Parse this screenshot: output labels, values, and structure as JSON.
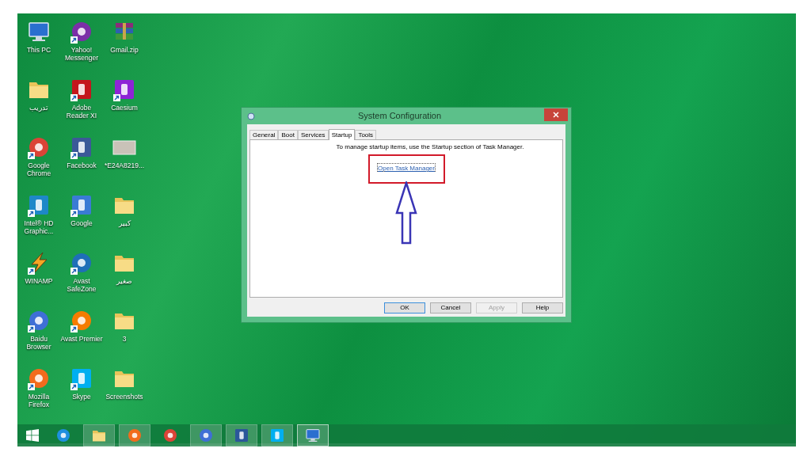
{
  "desktop_icons": [
    {
      "label": "This PC",
      "kind": "computer",
      "shortcut": false
    },
    {
      "label": "تدريب",
      "kind": "folder",
      "shortcut": false
    },
    {
      "label": "Google Chrome",
      "kind": "round",
      "color": "#db4437",
      "shortcut": true
    },
    {
      "label": "Intel® HD Graphic...",
      "kind": "tile",
      "color": "#1e88c8",
      "shortcut": true
    },
    {
      "label": "WINAMP",
      "kind": "bolt",
      "color": "#f5a623",
      "shortcut": true
    },
    {
      "label": "Baidu Browser",
      "kind": "round",
      "color": "#3f6fd6",
      "shortcut": true
    },
    {
      "label": "Mozilla Firefox",
      "kind": "round",
      "color": "#f26b1d",
      "shortcut": true
    },
    {
      "label": "Yahoo! Messenger",
      "kind": "round",
      "color": "#7b2fa8",
      "shortcut": true
    },
    {
      "label": "Adobe Reader XI",
      "kind": "tile",
      "color": "#c4161c",
      "shortcut": true
    },
    {
      "label": "Facebook",
      "kind": "tile",
      "color": "#3b5998",
      "shortcut": true
    },
    {
      "label": "Google",
      "kind": "tile",
      "color": "#3a7bd5",
      "shortcut": true
    },
    {
      "label": "Avast SafeZone",
      "kind": "round",
      "color": "#1f6fb8",
      "shortcut": true
    },
    {
      "label": "Avast Premier",
      "kind": "round",
      "color": "#f57c00",
      "shortcut": true
    },
    {
      "label": "Skype",
      "kind": "tile",
      "color": "#00aff0",
      "shortcut": true
    },
    {
      "label": "Gmail.zip",
      "kind": "archive",
      "shortcut": false
    },
    {
      "label": "Caesium",
      "kind": "tile",
      "color": "#8e24d6",
      "shortcut": true
    },
    {
      "label": "*E24A8219...",
      "kind": "image",
      "shortcut": false
    },
    {
      "label": "كبير",
      "kind": "folder",
      "shortcut": false
    },
    {
      "label": "صغير",
      "kind": "folder",
      "shortcut": false
    },
    {
      "label": "3",
      "kind": "folder",
      "shortcut": false
    },
    {
      "label": "Screenshots",
      "kind": "folder",
      "shortcut": false
    }
  ],
  "dialog": {
    "title": "System Configuration",
    "tabs": [
      {
        "label": "General",
        "selected": false
      },
      {
        "label": "Boot",
        "selected": false
      },
      {
        "label": "Services",
        "selected": false
      },
      {
        "label": "Startup",
        "selected": true
      },
      {
        "label": "Tools",
        "selected": false
      }
    ],
    "message": "To manage startup items, use the Startup section of Task Manager.",
    "link": "Open Task Manager",
    "buttons": [
      {
        "label": "OK",
        "default": true,
        "disabled": false
      },
      {
        "label": "Cancel",
        "default": false,
        "disabled": false
      },
      {
        "label": "Apply",
        "default": false,
        "disabled": true
      },
      {
        "label": "Help",
        "default": false,
        "disabled": false
      }
    ]
  },
  "taskbar": [
    {
      "kind": "round",
      "color": "#1e90e0",
      "running": false,
      "selected": false
    },
    {
      "kind": "folder",
      "running": true,
      "selected": false
    },
    {
      "kind": "round",
      "color": "#f26b1d",
      "running": true,
      "selected": false
    },
    {
      "kind": "round",
      "color": "#db4437",
      "running": false,
      "selected": false
    },
    {
      "kind": "round",
      "color": "#3f6fd6",
      "running": true,
      "selected": false
    },
    {
      "kind": "tile",
      "color": "#2b579a",
      "running": true,
      "selected": false
    },
    {
      "kind": "tile",
      "color": "#00aff0",
      "running": true,
      "selected": false
    },
    {
      "kind": "computer",
      "running": true,
      "selected": true
    }
  ]
}
